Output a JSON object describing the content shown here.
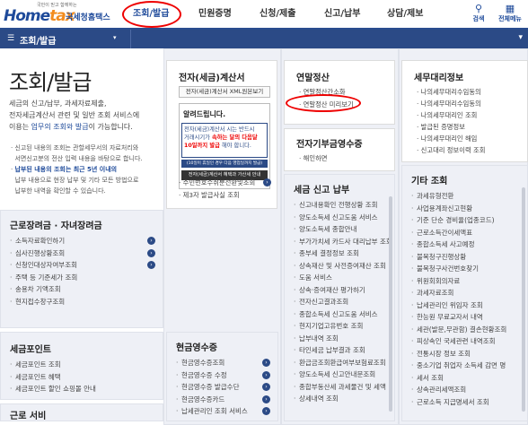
{
  "header": {
    "logo_small": "국민이 믿고 함께하는",
    "logo_main_a": "Home",
    "logo_main_b": "tax",
    "logo_sub": "국세청홈택스",
    "nav": [
      "조회/발급",
      "민원증명",
      "신청/제출",
      "신고/납부",
      "상담/제보"
    ],
    "search_label": "검색",
    "allmenu_label": "전체메뉴"
  },
  "subbar": {
    "title": "조회/발급",
    "caret": "▾",
    "right_icon": "▾"
  },
  "intro": {
    "title": "조회/발급",
    "desc_1": "세금의 신고/납부, 과세자료제출,",
    "desc_2": "전자세금계산서 관련 및 일반 조회 서비스에",
    "desc_3_pre": "이용는 ",
    "desc_3_hl": "업무의 조회와 발급",
    "desc_3_post": "이 가능합니다.",
    "notes": [
      "신고된 내용의 조회는 관할세무서의 자료처리와",
      "서면신고분의 전산 입력 내용을 바탕으로 합니다.",
      "납부된 내용의 조회는 최근 5년 이내의",
      "납부 내용으로 현장 납부 및 기타 모든 방법으로",
      "납부한 내역을 확인할 수 있습니다."
    ]
  },
  "panels": {
    "labor": {
      "title": "근로장려금 · 자녀장려금",
      "items": [
        "소득자료확인하기",
        "심사진행상황조회",
        "신청인대상자여부조회",
        "주택 등 기준세가 조회",
        "송용차 기액조회",
        "현지접수창구조회"
      ]
    },
    "point": {
      "title": "세금포인트",
      "items": [
        "세금포인트 조회",
        "세금포인트 혜택",
        "세금포인트 할인 쇼핑몰 안내"
      ]
    },
    "partial": {
      "title": "근로 서비"
    },
    "cash": {
      "title": "현금영수증",
      "items": [
        "현금영수증조회",
        "현금영수증 수정",
        "현금영수증 발급수단",
        "현금영수증카드",
        "납세관리인 조회 서비스"
      ]
    },
    "tax_report": {
      "title": "세금 신고 납부",
      "items": [
        "신고내용확인 전행상황 조회",
        "양도소득세 신고도움 서비스",
        "양도소득세 종합안내",
        "부가가치세 카드사 대리납부 조회",
        "종부세 결정정보 조회",
        "상속재산 및 사전증여재산 조회",
        "도움 서비스",
        "상속·증여재산 평가하기",
        "전자신고결과조회",
        "종합소득세 신고도움 서비스",
        "현지기업고유번호 조회",
        "납부내역 조회",
        "타인세금 납부결과 조회",
        "환급금조회환급여부보험료조회",
        "양도소득세 신고안내문조회",
        "종합부동산세 과세물건 및 세액",
        "상세내역 조회"
      ]
    },
    "etc": {
      "title": "기타 조회",
      "items": [
        "과세유형전환",
        "사업용계좌신고현황",
        "기준 단순 경비율(업종코드)",
        "근로소득간이세액표",
        "종합소득세 사고예정",
        "불복청구진행상황",
        "불복청구사건번호찾기",
        "위원회회의자료",
        "과세자료조회",
        "납세관리인 위임자 조회",
        "한능원 무료교자서 내역",
        "세관(발문,무관함) 결손현황조회",
        "피상속인 국세관련 내역조회",
        "전통시장 정보 조회",
        "중소기업 취업자 소득세 감면 명",
        "세서 조회",
        "상속관리세액조회",
        "근로소득 지급명세서 조회"
      ]
    }
  },
  "einvoice": {
    "title": "전자(세금)계산서",
    "button": "전자(세금)계산서 XML원본보기",
    "notice_title": "알려드립니다.",
    "notice_l1_a": "전자(세금)계산서 시는 반드시",
    "notice_l2_a": "거래시기가 ",
    "notice_l2_red": "속하는 달의 다음달",
    "notice_l3_red": "10일까지 발급",
    "notice_l3_b": "해야 합니다.",
    "notice_blue": "(10일이 휴일인 경우 다음 영업일까지 발급)",
    "notice_dark": "전자(세금)계산서 혜택과 가산세 안내",
    "items": [
      "주민번호수취분전환및조회",
      "제3자 발급사실 조회"
    ]
  },
  "yearend": {
    "title": "연말정산",
    "items": [
      "연말정산간소화",
      "연말정산 미리보기"
    ]
  },
  "donation": {
    "title": "전자기부금영수증",
    "items": [
      "해인하면"
    ]
  },
  "agent": {
    "title": "세무대리정보",
    "items": [
      "나의세무대리수임동의",
      "나의세무대리수임동의",
      "나의세무대리인 조회",
      "발급된 증명정보",
      "나의세무대리인 해임",
      "신고대리 정보이력 조회"
    ]
  }
}
